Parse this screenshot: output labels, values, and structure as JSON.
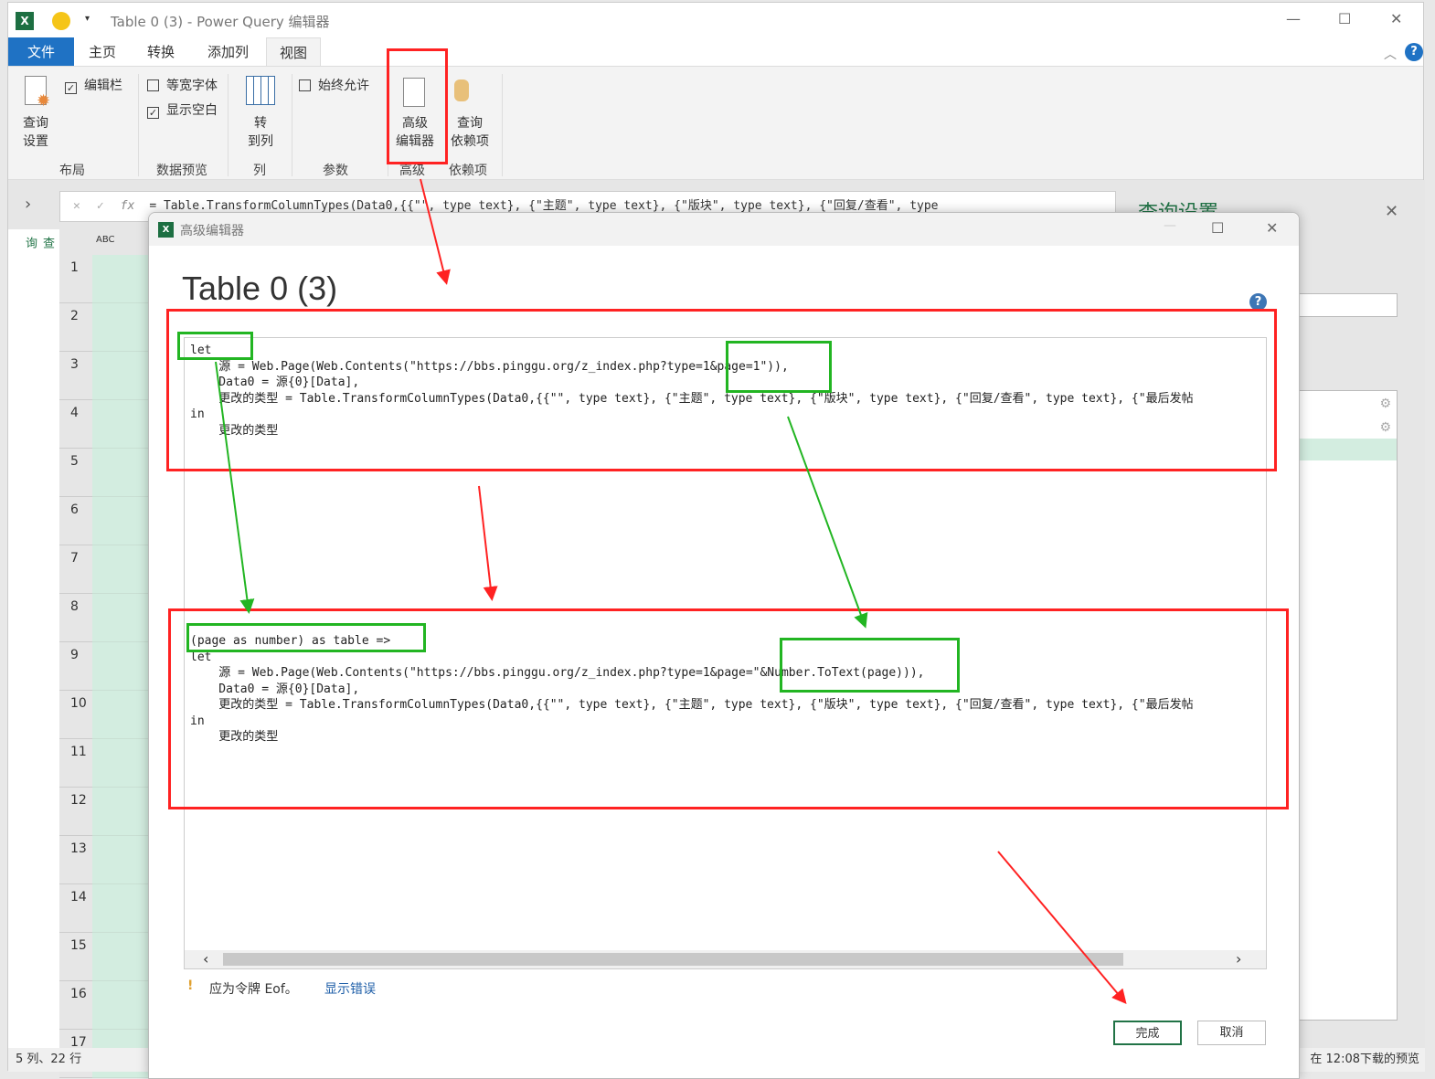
{
  "window": {
    "title": "Table 0 (3) - Power Query 编辑器"
  },
  "tabs": [
    {
      "label": "文件"
    },
    {
      "label": "主页"
    },
    {
      "label": "转换"
    },
    {
      "label": "添加列"
    },
    {
      "label": "视图",
      "active": true
    }
  ],
  "ribbon": {
    "query_settings": "查询\n设置",
    "formula_bar": "编辑栏",
    "formula_bar_checked": true,
    "monospace": "等宽字体",
    "monospace_checked": false,
    "show_whitespace": "显示空白",
    "show_whitespace_checked": true,
    "go_to_column": "转\n到列",
    "always_allow": "始终允许",
    "always_allow_checked": false,
    "advanced_editor": "高级\n编辑器",
    "query_dependencies": "查询\n依赖项",
    "groups": [
      "布局",
      "数据预览",
      "列",
      "参数",
      "高级",
      "依赖项"
    ]
  },
  "formula": "= Table.TransformColumnTypes(Data0,{{\"\", type text}, {\"主题\", type text}, {\"版块\", type text}, {\"回复/查看\", type",
  "nav_label": "查询",
  "grid": {
    "column_type": "ABC",
    "rows": [
      "1",
      "2",
      "3",
      "4",
      "5",
      "6",
      "7",
      "8",
      "9",
      "10",
      "11",
      "12",
      "13",
      "14",
      "15",
      "16",
      "17"
    ]
  },
  "query_settings_title": "查询设置",
  "status": {
    "left": "5 列、22 行",
    "right": "在 12:08下载的预览"
  },
  "dialog": {
    "title": "高级编辑器",
    "query_name": "Table 0 (3)",
    "code_before": [
      "let",
      "    源 = Web.Page(Web.Contents(\"https://bbs.pinggu.org/z_index.php?type=1&page=1\")),",
      "    Data0 = 源{0}[Data],",
      "    更改的类型 = Table.TransformColumnTypes(Data0,{{\"\", type text}, {\"主题\", type text}, {\"版块\", type text}, {\"回复/查看\", type text}, {\"最后发帖",
      "in",
      "    更改的类型"
    ],
    "code_after": [
      "(page as number) as table =>",
      "let",
      "    源 = Web.Page(Web.Contents(\"https://bbs.pinggu.org/z_index.php?type=1&page=\"&Number.ToText(page))),",
      "    Data0 = 源{0}[Data],",
      "    更改的类型 = Table.TransformColumnTypes(Data0,{{\"\", type text}, {\"主题\", type text}, {\"版块\", type text}, {\"回复/查看\", type text}, {\"最后发帖",
      "in",
      "    更改的类型"
    ],
    "error": "应为令牌 Eof。",
    "show_error": "显示错误",
    "done": "完成",
    "cancel": "取消"
  },
  "colors": {
    "annotation_red": "#ff2222",
    "annotation_green": "#22b522",
    "file_tab": "#1f72c4",
    "accent_green": "#217346"
  }
}
